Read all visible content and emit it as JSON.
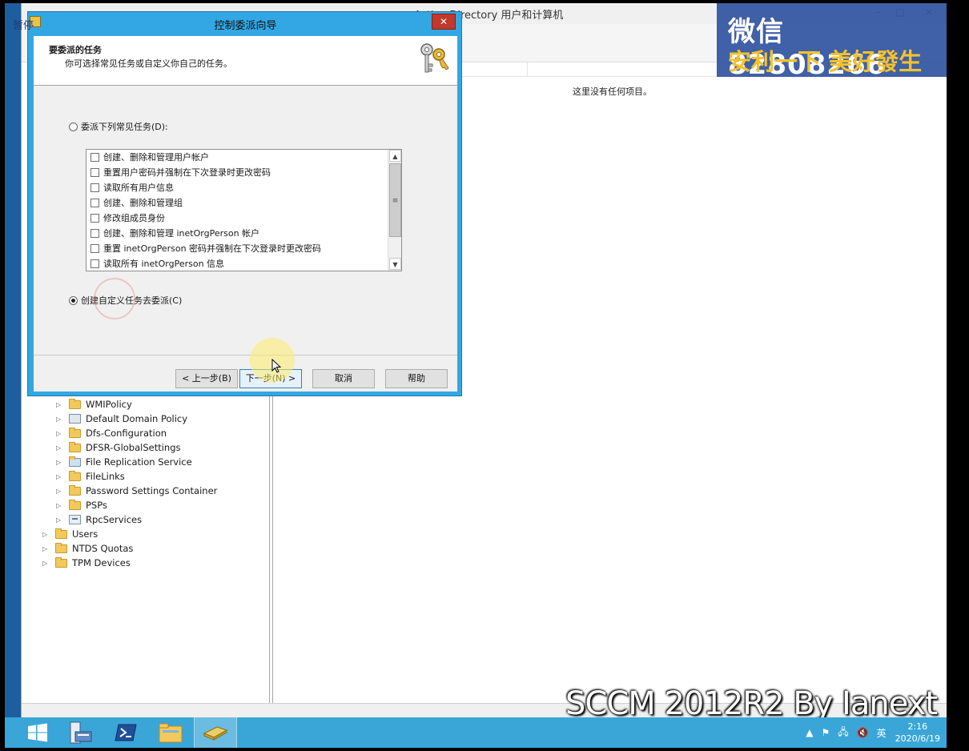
{
  "main_window": {
    "title": "Active Directory 用户和计算机",
    "empty_message": "这里没有任何项目。",
    "tree_items": [
      {
        "label": "WMIPolicy",
        "icon": "folder-icon",
        "indent": 1
      },
      {
        "label": "Default Domain Policy",
        "icon": "gpo-icon",
        "indent": 1
      },
      {
        "label": "Dfs-Configuration",
        "icon": "folder-icon",
        "indent": 1
      },
      {
        "label": "DFSR-GlobalSettings",
        "icon": "folder-icon",
        "indent": 1
      },
      {
        "label": "File Replication Service",
        "icon": "service-folder-icon",
        "indent": 1
      },
      {
        "label": "FileLinks",
        "icon": "folder-icon",
        "indent": 1
      },
      {
        "label": "Password Settings Container",
        "icon": "folder-icon",
        "indent": 1
      },
      {
        "label": "PSPs",
        "icon": "folder-icon",
        "indent": 1
      },
      {
        "label": "RpcServices",
        "icon": "rpc-icon",
        "indent": 1
      },
      {
        "label": "Users",
        "icon": "folder-icon",
        "indent": 0
      },
      {
        "label": "NTDS Quotas",
        "icon": "folder-icon",
        "indent": 0
      },
      {
        "label": "TPM Devices",
        "icon": "folder-icon",
        "indent": 0
      }
    ]
  },
  "dialog": {
    "title": "控制委派向导",
    "pause_label": "暂停",
    "header_title": "要委派的任务",
    "header_subtitle": "你可选择常见任务或自定义你自己的任务。",
    "radio_common": {
      "label": "委派下列常见任务(D):",
      "selected": false
    },
    "radio_custom": {
      "label": "创建自定义任务去委派(C)",
      "selected": true
    },
    "tasks": [
      "创建、删除和管理用户帐户",
      "重置用户密码并强制在下次登录时更改密码",
      "读取所有用户信息",
      "创建、删除和管理组",
      "修改组成员身份",
      "创建、删除和管理 inetOrgPerson 帐户",
      "重置 inetOrgPerson 密码并强制在下次登录时更改密码",
      "读取所有 inetOrgPerson 信息"
    ],
    "buttons": {
      "back": "< 上一步(B)",
      "next": "下一步(N) >",
      "cancel": "取消",
      "help": "帮助"
    }
  },
  "watermark": {
    "line1": "微信 82808266",
    "line2": "安利一下 美好發生",
    "credit": "SCCM 2012R2 By Ianext"
  },
  "taskbar": {
    "apps": [
      "start-icon",
      "server-manager-icon",
      "powershell-icon",
      "file-explorer-icon",
      "ad-users-computers-icon"
    ],
    "ime": "英",
    "time": "2:16",
    "date": "2020/6/19"
  },
  "colors": {
    "dialog_frame": "#33a7e4",
    "taskbar": "#3aa6d8",
    "watermark_bg": "#3052a0",
    "watermark_accent": "#f5c22b"
  }
}
